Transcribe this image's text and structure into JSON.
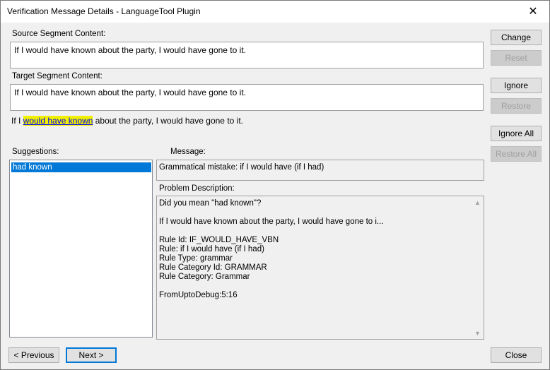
{
  "window": {
    "title": "Verification Message Details - LanguageTool Plugin",
    "close_glyph": "✕"
  },
  "source": {
    "label": "Source Segment Content:",
    "value": "If I would have known about the party, I would have gone to it."
  },
  "target": {
    "label": "Target Segment Content:",
    "value": "If I would have known about the party, I would have gone to it."
  },
  "preview": {
    "before": "If I ",
    "highlight": "would have known",
    "after": " about the party, I would have gone to it."
  },
  "suggestions": {
    "label": "Suggestions:",
    "items": [
      "had known"
    ]
  },
  "message": {
    "label": "Message:",
    "value": "Grammatical mistake: if I would have (if I had)"
  },
  "problem": {
    "label": "Problem Description:",
    "lines": [
      "Did you mean \"had known\"?",
      "",
      "If I would have known about the party, I would have gone to i...",
      "",
      "Rule Id: IF_WOULD_HAVE_VBN",
      "Rule: if I would have (if I had)",
      "Rule Type: grammar",
      "Rule Category Id: GRAMMAR",
      "Rule Category: Grammar",
      "",
      "FromUptoDebug:5:16"
    ]
  },
  "buttons": {
    "change": "Change",
    "reset": "Reset",
    "ignore": "Ignore",
    "restore": "Restore",
    "ignore_all": "Ignore All",
    "restore_all": "Restore All",
    "previous": "< Previous",
    "next": "Next >",
    "close": "Close"
  }
}
